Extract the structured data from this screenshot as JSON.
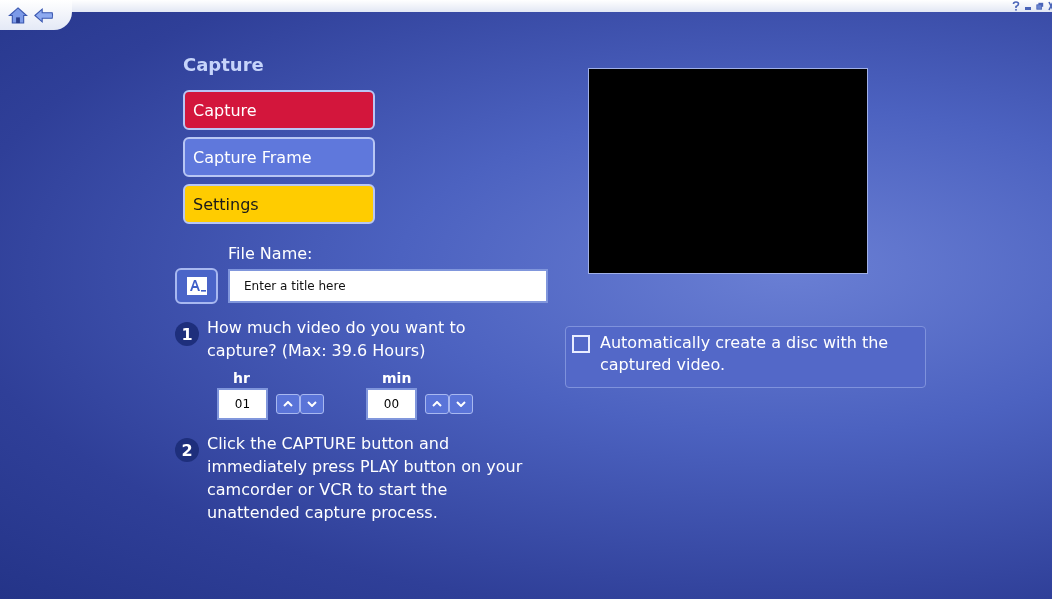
{
  "page": {
    "title": "Capture"
  },
  "menu": [
    {
      "label": "Capture",
      "color": "#d3163c"
    },
    {
      "label": "Capture Frame",
      "color": "#5f78dc"
    },
    {
      "label": "Settings",
      "color": "#ffcc00"
    }
  ],
  "file_name": {
    "label": "File Name:",
    "placeholder": "Enter a title here"
  },
  "steps": [
    {
      "number": "1",
      "text": "How much video do you want to capture? (Max: 39.6 Hours)"
    },
    {
      "number": "2",
      "text": "Click the CAPTURE button and immediately press PLAY button on your camcorder or VCR to start the unattended capture process."
    }
  ],
  "duration": [
    {
      "label": "hr",
      "value": "01"
    },
    {
      "label": "min",
      "value": "00"
    }
  ],
  "auto_disc": {
    "label": "Automatically create a disc with the captured video.",
    "checked": false
  }
}
